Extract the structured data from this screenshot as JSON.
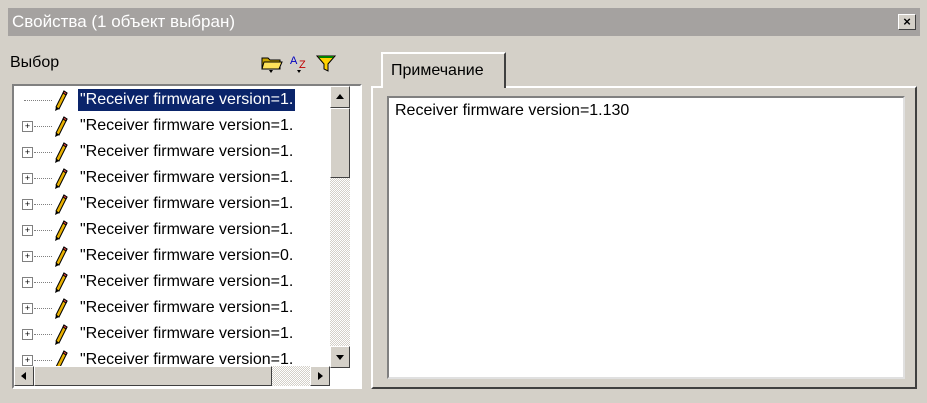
{
  "window": {
    "title": "Свойства (1 объект выбран)",
    "close_glyph": "×"
  },
  "left_panel": {
    "header_label": "Выбор",
    "toolbar": [
      {
        "name": "open-folder-icon",
        "glyph": "folder"
      },
      {
        "name": "sort-az-icon",
        "glyph": "AZ"
      },
      {
        "name": "filter-icon",
        "glyph": "funnel"
      }
    ],
    "tree": {
      "rows": [
        {
          "label": "\"Receiver firmware version=1.",
          "expandable": false,
          "selected": true
        },
        {
          "label": "\"Receiver firmware version=1.",
          "expandable": true,
          "selected": false
        },
        {
          "label": "\"Receiver firmware version=1.",
          "expandable": true,
          "selected": false
        },
        {
          "label": "\"Receiver firmware version=1.",
          "expandable": true,
          "selected": false
        },
        {
          "label": "\"Receiver firmware version=1.",
          "expandable": true,
          "selected": false
        },
        {
          "label": "\"Receiver firmware version=1.",
          "expandable": true,
          "selected": false
        },
        {
          "label": "\"Receiver firmware version=0.",
          "expandable": true,
          "selected": false
        },
        {
          "label": "\"Receiver firmware version=1.",
          "expandable": true,
          "selected": false
        },
        {
          "label": "\"Receiver firmware version=1.",
          "expandable": true,
          "selected": false
        },
        {
          "label": "\"Receiver firmware version=1.",
          "expandable": true,
          "selected": false
        },
        {
          "label": "\"Receiver firmware version=1.",
          "expandable": true,
          "selected": false
        }
      ]
    }
  },
  "right_panel": {
    "tab_label": "Примечание",
    "note_text": "Receiver firmware version=1.130"
  },
  "colors": {
    "titlebar": "#a5a2a0",
    "face": "#d4d0c8",
    "selection": "#0a246a"
  }
}
